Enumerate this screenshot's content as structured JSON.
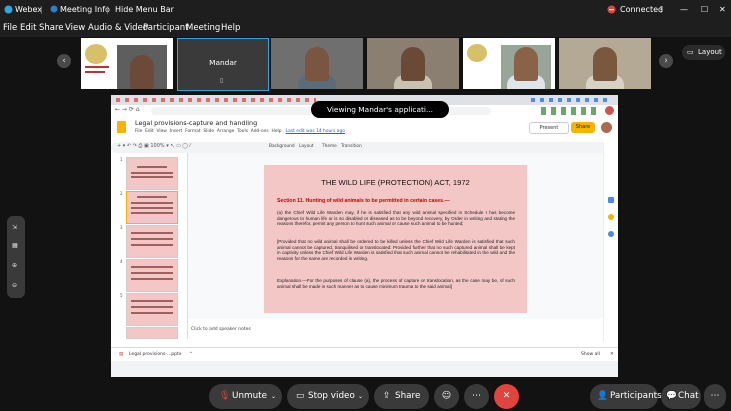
{
  "titlebar": {
    "app": "Webex",
    "meeting_info": "Meeting Info",
    "hide_menu": "Hide Menu Bar",
    "status": "Connected",
    "status_color": "#e0443e"
  },
  "menu": [
    "File",
    "Edit",
    "Share",
    "View",
    "Audio & Video",
    "Participant",
    "Meeting",
    "Help"
  ],
  "participants": {
    "active_name": "Mandar",
    "layout_label": "Layout"
  },
  "banner": {
    "text": "Viewing Mandar's applicati..."
  },
  "doc": {
    "title": "Legal provisions-capture and handling",
    "menu": [
      "File",
      "Edit",
      "View",
      "Insert",
      "Format",
      "Slide",
      "Arrange",
      "Tools",
      "Add-ons",
      "Help"
    ],
    "last_edit": "Last edit was 14 hours ago",
    "present_label": "Present",
    "share_label": "Share",
    "tool_items": [
      "Background",
      "Layout",
      "Theme",
      "Transition"
    ],
    "speaker_notes": "Click to add speaker notes",
    "download_file": "Legal provisions-...pptx",
    "show_all": "Show all"
  },
  "slide": {
    "title": "THE WILD LIFE (PROTECTION) ACT, 1972",
    "section": "Section 11. Hunting of wild animals to be permitted in certain cases.—",
    "para_a": "(a) the Chief Wild Life Warden may, if he is satisfied that any wild animal specified in Schedule I has become dangerous to human life or is so disabled or diseased as to be beyond recovery, by Order in writing and stating the reasons therefor, permit any person to hunt such animal or cause such animal to be hunted;",
    "para_b": "[Provided that no wild animal shall be ordered to be killed unless the Chief Wild Life Warden is satisfied that such animal cannot be captured, tranquilised or translocated: Provided further that no such captured animal shall be kept in captivity unless the Chief Wild Life Warden is satisfied that such animal cannot be rehabilitated in the wild and the reasons for the same are recorded in writing.",
    "para_c": "Explanation.—For the purposes of clause (a), the process of capture or translocation, as the case may be, of such animal shall be made in such manner as to cause minimum trauma to the said animal]",
    "bg_color": "#f4c7c7",
    "section_color": "#cc0000"
  },
  "slide_numbers": [
    "1",
    "2",
    "3",
    "4",
    "5"
  ],
  "controls": {
    "unmute": "Unmute",
    "stop_video": "Stop video",
    "share": "Share",
    "participants": "Participants",
    "chat": "Chat"
  }
}
